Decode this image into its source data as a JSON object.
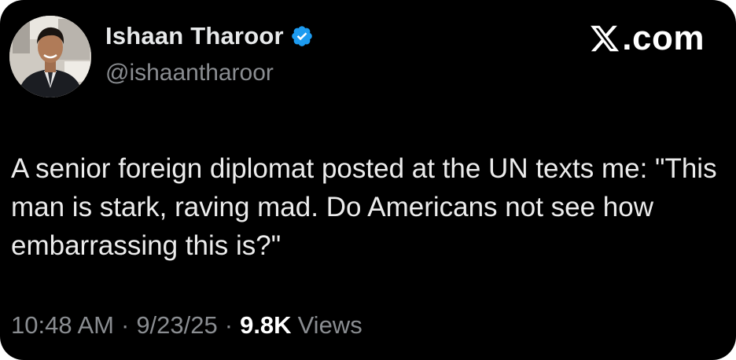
{
  "author": {
    "name": "Ishaan Tharoor",
    "handle": "@ishaantharoor",
    "verified": true,
    "avatar_icon": "profile-photo"
  },
  "brand": {
    "label": ".com",
    "logo_icon": "x-logo-icon"
  },
  "tweet": {
    "text": "A senior foreign diplomat posted at the UN texts me: \"This man is stark, raving mad. Do Americans not see how embarrassing this is?\""
  },
  "meta": {
    "time": "10:48 AM",
    "separator": "·",
    "date": "9/23/25",
    "views_count": "9.8K",
    "views_label": "Views"
  },
  "colors": {
    "background": "#000000",
    "text_primary": "#e7e9ea",
    "text_secondary": "#8a8d91",
    "verified_badge": "#1d9bf0"
  }
}
